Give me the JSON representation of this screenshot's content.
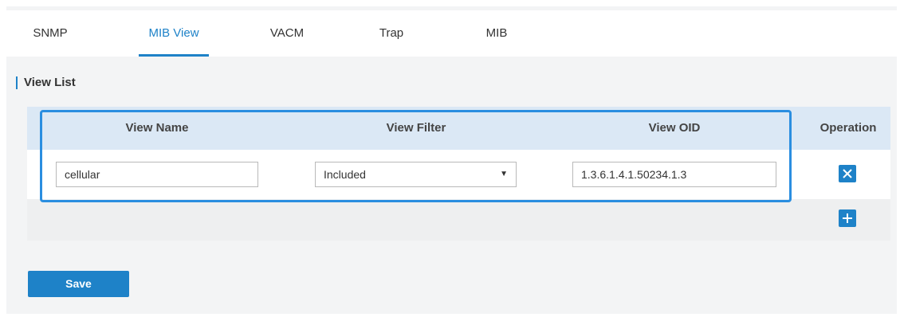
{
  "tabs": [
    {
      "label": "SNMP",
      "active": false
    },
    {
      "label": "MIB View",
      "active": true
    },
    {
      "label": "VACM",
      "active": false
    },
    {
      "label": "Trap",
      "active": false
    },
    {
      "label": "MIB",
      "active": false
    }
  ],
  "section": {
    "title": "View List"
  },
  "table": {
    "headers": {
      "view_name": "View Name",
      "view_filter": "View Filter",
      "view_oid": "View OID",
      "operation": "Operation"
    },
    "rows": [
      {
        "view_name": "cellular",
        "view_filter": "Included",
        "view_oid": "1.3.6.1.4.1.50234.1.3"
      }
    ]
  },
  "buttons": {
    "save": "Save"
  },
  "icons": {
    "delete": "close-icon",
    "add": "plus-icon",
    "select_arrow": "caret-down-icon"
  },
  "colors": {
    "accent": "#1e82c8",
    "highlight_border": "#2a8ee0",
    "table_header_bg": "#dbe8f5"
  }
}
